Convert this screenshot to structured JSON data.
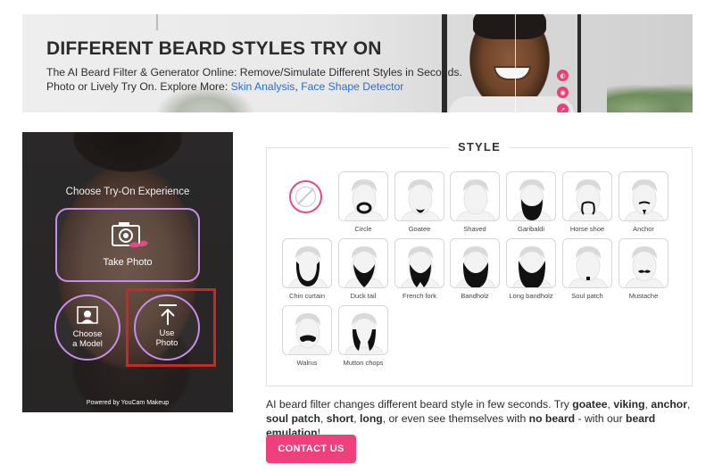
{
  "banner": {
    "title": "DIFFERENT BEARD STYLES TRY ON",
    "desc_line1": "The AI Beard Filter & Generator Online: Remove/Simulate Different Styles in Seconds.",
    "desc_line2_prefix": "Photo or Lively Try On. Explore More: ",
    "link_skin": "Skin Analysis",
    "link_sep": ", ",
    "link_face": "Face Shape Detector",
    "side_icons": [
      "compare-icon",
      "camera-icon",
      "share-icon"
    ]
  },
  "tryon": {
    "heading": "Choose Try-On Experience",
    "take_photo": "Take Photo",
    "choose_model_line1": "Choose",
    "choose_model_line2": "a Model",
    "use_photo_line1": "Use",
    "use_photo_line2": "Photo",
    "powered_by": "Powered by YouCam Makeup",
    "highlight_color": "#c72a24",
    "accent_color": "#c88de6"
  },
  "style": {
    "title": "STYLE",
    "styles": [
      {
        "label": "Circle",
        "shape": "circle"
      },
      {
        "label": "Goatee",
        "shape": "goatee"
      },
      {
        "label": "Shaved",
        "shape": "shaved"
      },
      {
        "label": "Garibaldi",
        "shape": "garibaldi"
      },
      {
        "label": "Horse shoe",
        "shape": "horseshoe"
      },
      {
        "label": "Anchor",
        "shape": "anchor"
      },
      {
        "label": "Chin curtain",
        "shape": "chincurtain"
      },
      {
        "label": "Duck tail",
        "shape": "ducktail"
      },
      {
        "label": "French fork",
        "shape": "frenchfork"
      },
      {
        "label": "Bandholz",
        "shape": "bandholz"
      },
      {
        "label": "Long bandholz",
        "shape": "longbandholz"
      },
      {
        "label": "Soul patch",
        "shape": "soulpatch"
      },
      {
        "label": "Mustache",
        "shape": "mustache"
      },
      {
        "label": "Walrus",
        "shape": "walrus"
      },
      {
        "label": "Mutton chops",
        "shape": "muttonchops"
      }
    ],
    "selected_accent": "#e64a86"
  },
  "description": {
    "p1": "AI beard filter changes different beard style in few seconds. Try ",
    "b1": "goatee",
    "p2": ", ",
    "b2": "viking",
    "p3": ", ",
    "b3": "anchor",
    "p4": ", ",
    "b4": "soul patch",
    "p5": ", ",
    "b5": "short",
    "p6": ", ",
    "b6": "long",
    "p7": ", or even see themselves with ",
    "b7": "no beard",
    "p8": " - with our ",
    "b8": "beard emulation",
    "p9": "!"
  },
  "cta": {
    "label": "CONTACT US",
    "color": "#f03f7d"
  }
}
